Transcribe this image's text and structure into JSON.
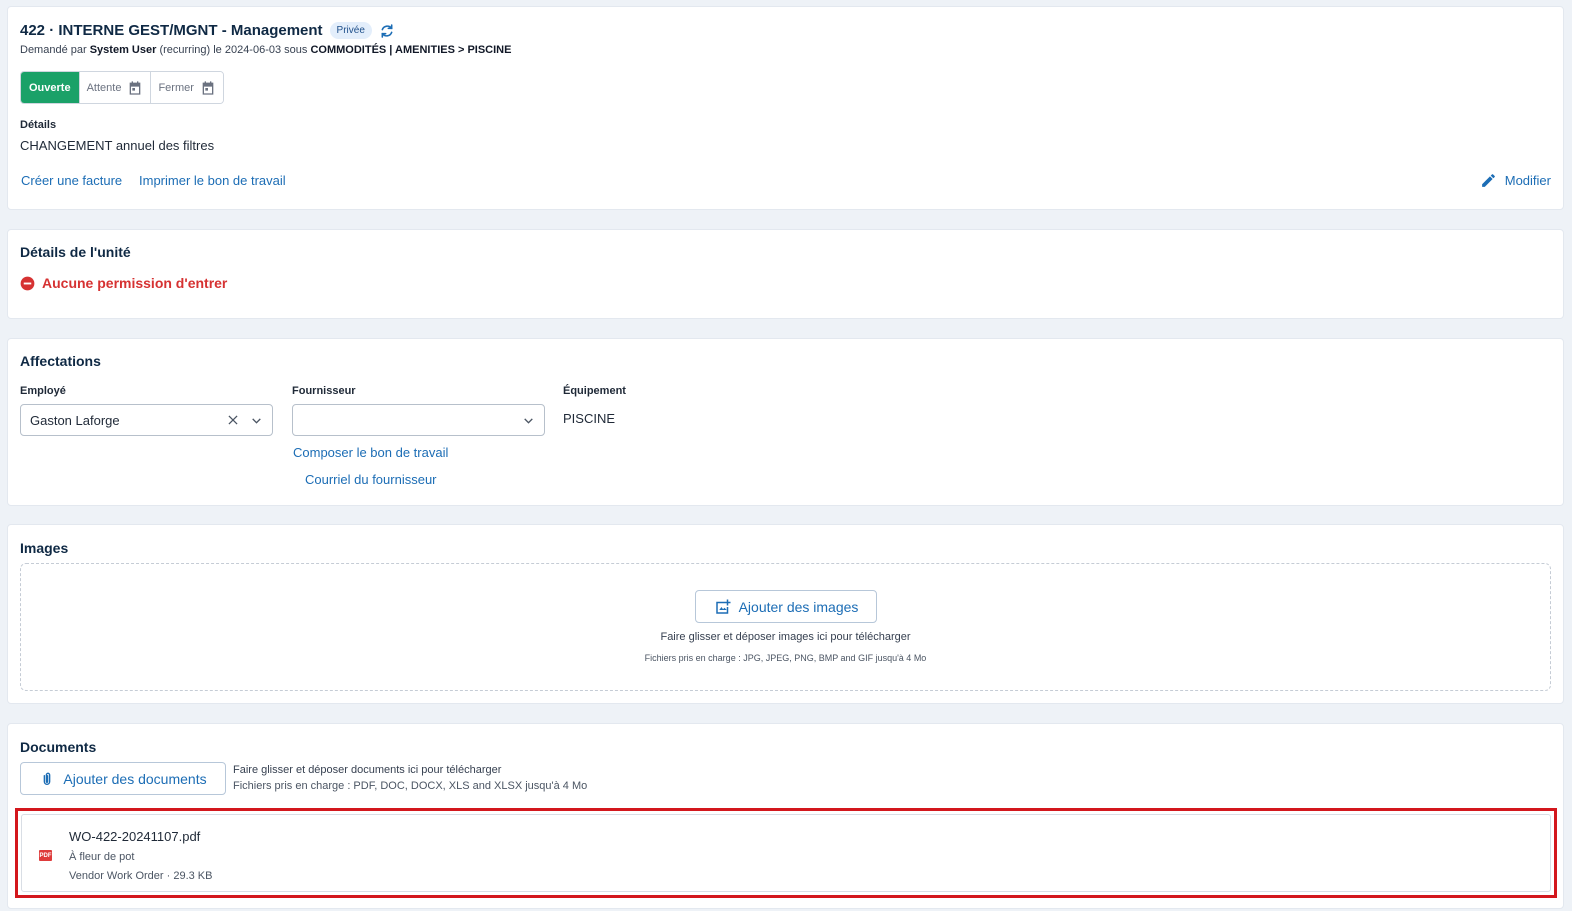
{
  "header": {
    "title": "422 · INTERNE GEST/MGNT - Management",
    "badge": "Privée",
    "requested_prefix": "Demandé par",
    "requested_by": "System User",
    "requested_mid": "(recurring) le 2024-06-03 sous",
    "category": "COMMODITÉS | AMENITIES > PISCINE",
    "statuses": [
      "Ouverte",
      "Attente",
      "Fermer"
    ],
    "details_label": "Détails",
    "details_text": "CHANGEMENT annuel des filtres",
    "link_invoice": "Créer une facture",
    "link_print": "Imprimer le bon de travail",
    "edit_label": "Modifier"
  },
  "unit": {
    "title": "Détails de l'unité",
    "no_entry": "Aucune permission d'entrer"
  },
  "assignments": {
    "title": "Affectations",
    "employee_label": "Employé",
    "employee_value": "Gaston Laforge",
    "supplier_label": "Fournisseur",
    "supplier_value": "",
    "equipment_label": "Équipement",
    "equipment_value": "PISCINE",
    "link_compose": "Composer le bon de travail",
    "link_email": "Courriel du fournisseur"
  },
  "images": {
    "title": "Images",
    "add_button": "Ajouter des images",
    "hint": "Faire glisser et déposer images ici pour télécharger",
    "formats": "Fichiers pris en charge : JPG, JPEG, PNG, BMP and GIF jusqu'à 4 Mo"
  },
  "documents": {
    "title": "Documents",
    "add_button": "Ajouter des documents",
    "hint": "Faire glisser et déposer documents ici pour télécharger",
    "formats": "Fichiers pris en charge : PDF, DOC, DOCX, XLS and XLSX jusqu'à 4 Mo",
    "files": [
      {
        "name": "WO-422-20241107.pdf",
        "description": "À fleur de pot",
        "meta": "Vendor Work Order · 29.3 KB",
        "icon_text": "PDF"
      }
    ]
  },
  "colors": {
    "accent": "#1c6db5",
    "open_status": "#1aa168",
    "danger": "#d63232",
    "highlight": "#d3171d"
  }
}
